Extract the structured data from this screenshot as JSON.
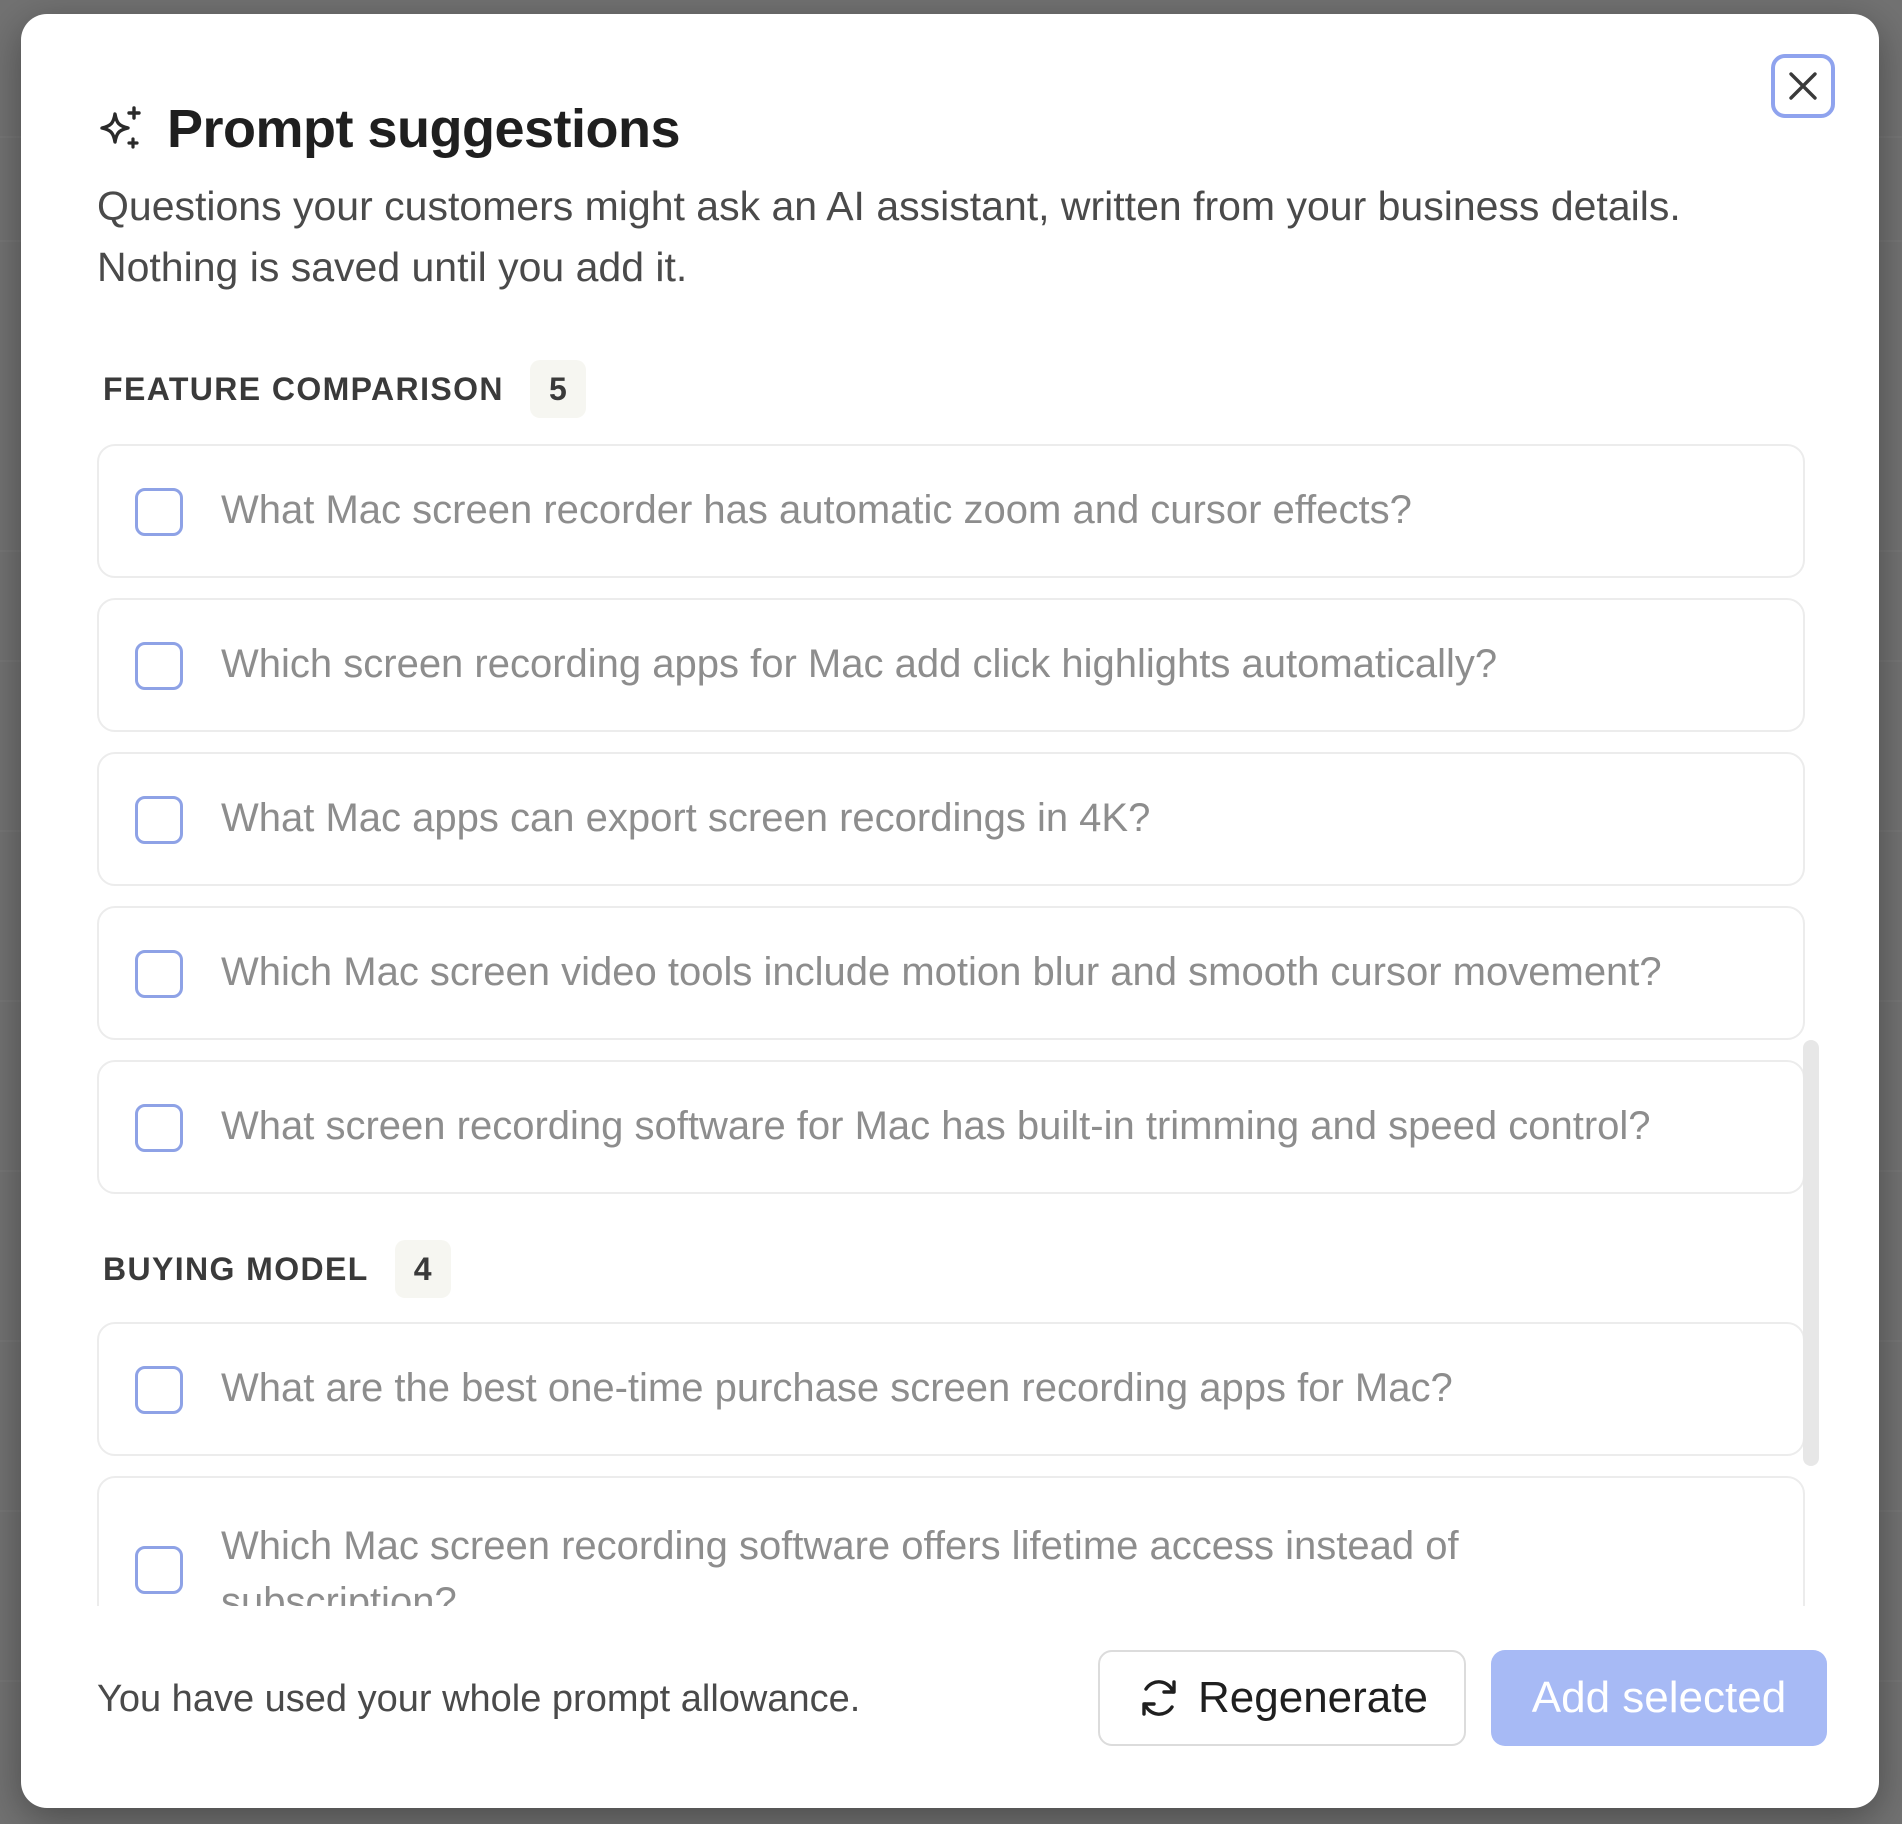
{
  "modal": {
    "title": "Prompt suggestions",
    "subtitle": "Questions your customers might ask an AI assistant, written from your business details. Nothing is saved until you add it.",
    "close_icon": "close-icon",
    "title_icon": "sparkles-icon"
  },
  "sections": [
    {
      "label": "FEATURE COMPARISON",
      "count": "5",
      "items": [
        {
          "text": "What Mac screen recorder has automatic zoom and cursor effects?",
          "checked": false
        },
        {
          "text": "Which screen recording apps for Mac add click highlights automatically?",
          "checked": false
        },
        {
          "text": "What Mac apps can export screen recordings in 4K?",
          "checked": false
        },
        {
          "text": "Which Mac screen video tools include motion blur and smooth cursor movement?",
          "checked": false
        },
        {
          "text": "What screen recording software for Mac has built-in trimming and speed control?",
          "checked": false
        }
      ]
    },
    {
      "label": "BUYING MODEL",
      "count": "4",
      "items": [
        {
          "text": "What are the best one-time purchase screen recording apps for Mac?",
          "checked": false
        },
        {
          "text": "Which Mac screen recording software offers lifetime access instead of subscription?",
          "checked": false
        }
      ]
    }
  ],
  "footer": {
    "note": "You have used your whole prompt allowance.",
    "regenerate_label": "Regenerate",
    "regenerate_icon": "refresh-icon",
    "add_label": "Add selected"
  },
  "colors": {
    "accent": "#8fa3ee",
    "add_button_disabled": "#a7baf5",
    "checkbox_border": "#8ea2e6"
  }
}
